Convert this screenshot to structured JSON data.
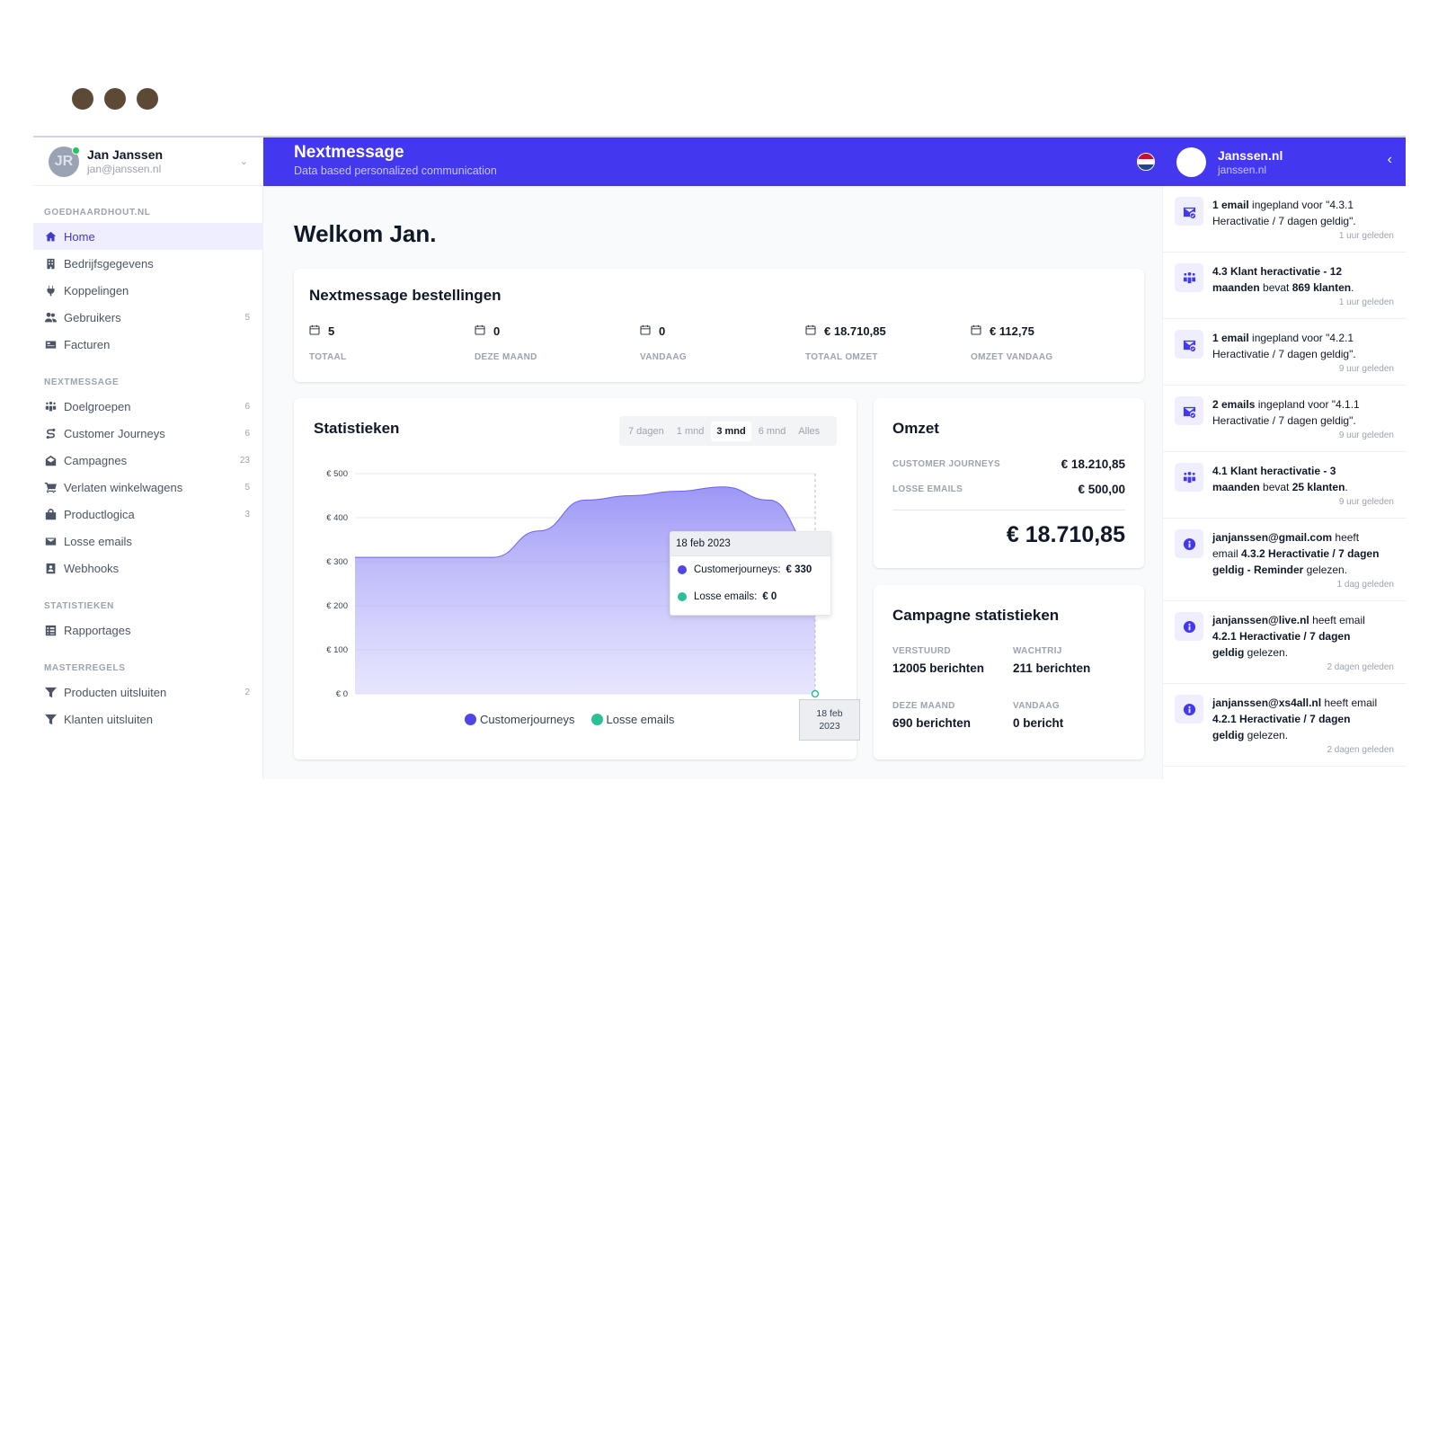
{
  "user": {
    "initials": "JR",
    "name": "Jan Janssen",
    "email": "jan@janssen.nl"
  },
  "nav": [
    {
      "section": "GOEDHAARDHOUT.NL",
      "items": [
        {
          "label": "Home",
          "icon": "home-icon",
          "count": "",
          "active": true
        },
        {
          "label": "Bedrijfsgegevens",
          "icon": "building-icon",
          "count": ""
        },
        {
          "label": "Koppelingen",
          "icon": "plug-icon",
          "count": ""
        },
        {
          "label": "Gebruikers",
          "icon": "users-icon",
          "count": "5"
        },
        {
          "label": "Facturen",
          "icon": "invoice-icon",
          "count": ""
        }
      ]
    },
    {
      "section": "NEXTMESSAGE",
      "items": [
        {
          "label": "Doelgroepen",
          "icon": "group-icon",
          "count": "6"
        },
        {
          "label": "Customer Journeys",
          "icon": "route-icon",
          "count": "6"
        },
        {
          "label": "Campagnes",
          "icon": "mail-open-icon",
          "count": "23"
        },
        {
          "label": "Verlaten winkelwagens",
          "icon": "cart-icon",
          "count": "5"
        },
        {
          "label": "Productlogica",
          "icon": "bag-icon",
          "count": "3"
        },
        {
          "label": "Losse emails",
          "icon": "mail-icon",
          "count": ""
        },
        {
          "label": "Webhooks",
          "icon": "webhook-icon",
          "count": ""
        }
      ]
    },
    {
      "section": "STATISTIEKEN",
      "items": [
        {
          "label": "Rapportages",
          "icon": "report-icon",
          "count": ""
        }
      ]
    },
    {
      "section": "MASTERREGELS",
      "items": [
        {
          "label": "Producten uitsluiten",
          "icon": "filter-icon",
          "count": "2"
        },
        {
          "label": "Klanten uitsluiten",
          "icon": "filter-icon",
          "count": ""
        }
      ]
    }
  ],
  "header": {
    "title": "Nextmessage",
    "subtitle": "Data based personalized communication",
    "account_name": "Janssen.nl",
    "account_domain": "janssen.nl"
  },
  "welcome": "Welkom Jan.",
  "orders": {
    "title": "Nextmessage bestellingen",
    "stats": [
      {
        "value": "5",
        "label": "TOTAAL"
      },
      {
        "value": "0",
        "label": "DEZE MAAND"
      },
      {
        "value": "0",
        "label": "VANDAAG"
      },
      {
        "value": "€ 18.710,85",
        "label": "TOTAAL OMZET"
      },
      {
        "value": "€ 112,75",
        "label": "OMZET VANDAAG"
      }
    ]
  },
  "statistics": {
    "title": "Statistieken",
    "ranges": [
      "7 dagen",
      "1 mnd",
      "3 mnd",
      "6 mnd",
      "Alles"
    ],
    "selected_range": "3 mnd",
    "tooltip": {
      "date": "18 feb 2023",
      "rows": [
        {
          "label": "Customerjourneys:",
          "value": "€ 330"
        },
        {
          "label": "Losse emails:",
          "value": "€ 0"
        }
      ]
    },
    "x_tooltip": [
      "18 feb",
      "2023"
    ]
  },
  "chart_data": {
    "type": "area",
    "ylim": [
      0,
      500
    ],
    "yticks": [
      "€ 0",
      "€ 100",
      "€ 200",
      "€ 300",
      "€ 400",
      "€ 500"
    ],
    "ytick_values": [
      0,
      100,
      200,
      300,
      400,
      500
    ],
    "x": [
      0,
      1,
      2,
      3,
      4,
      5,
      6,
      7,
      8,
      9,
      10
    ],
    "series": [
      {
        "name": "Customerjourneys",
        "color": "#4f46e5",
        "values": [
          310,
          310,
          310,
          310,
          370,
          440,
          450,
          460,
          470,
          440,
          330
        ]
      },
      {
        "name": "Losse emails",
        "color": "#2bbf95",
        "values": [
          0,
          0,
          0,
          0,
          0,
          0,
          0,
          0,
          0,
          0,
          0
        ]
      }
    ],
    "grid": true,
    "legend": "bottom"
  },
  "omzet": {
    "title": "Omzet",
    "rows": [
      {
        "label": "CUSTOMER JOURNEYS",
        "value": "€ 18.210,85"
      },
      {
        "label": "LOSSE EMAILS",
        "value": "€ 500,00"
      }
    ],
    "total": "€ 18.710,85"
  },
  "campagne": {
    "title": "Campagne statistieken",
    "items": [
      {
        "label": "VERSTUURD",
        "value": "12005 berichten"
      },
      {
        "label": "WACHTRIJ",
        "value": "211 berichten"
      },
      {
        "label": "DEZE MAAND",
        "value": "690 berichten"
      },
      {
        "label": "VANDAAG",
        "value": "0 bericht"
      }
    ]
  },
  "notifications": [
    {
      "icon": "mail-check-icon",
      "html": "<b>1 email</b> ingepland voor \"4.3.1 Heractivatie / 7 dagen geldig\".",
      "time": "1 uur geleden"
    },
    {
      "icon": "group-icon",
      "html": "<b>4.3 Klant heractivatie - 12 maanden</b> bevat <b>869 klanten</b>.",
      "time": "1 uur geleden"
    },
    {
      "icon": "mail-check-icon",
      "html": "<b>1 email</b> ingepland voor \"4.2.1 Heractivatie / 7 dagen geldig\".",
      "time": "9 uur geleden"
    },
    {
      "icon": "mail-check-icon",
      "html": "<b>2 emails</b> ingepland voor \"4.1.1 Heractivatie / 7 dagen geldig\".",
      "time": "9 uur geleden"
    },
    {
      "icon": "group-icon",
      "html": "<b>4.1 Klant heractivatie - 3 maanden</b> bevat <b>25 klanten</b>.",
      "time": "9 uur geleden"
    },
    {
      "icon": "info-icon",
      "html": "<b>janjanssen@gmail.com</b> heeft email <b>4.3.2 Heractivatie / 7 dagen geldig - Reminder</b> gelezen.",
      "time": "1 dag geleden"
    },
    {
      "icon": "info-icon",
      "html": "<b>janjanssen@live.nl</b> heeft email <b>4.2.1 Heractivatie / 7 dagen geldig</b> gelezen.",
      "time": "2 dagen geleden"
    },
    {
      "icon": "info-icon",
      "html": "<b>janjanssen@xs4all.nl</b> heeft email <b>4.2.1 Heractivatie / 7 dagen geldig</b> gelezen.",
      "time": "2 dagen geleden"
    }
  ],
  "colors": {
    "accent": "#4338f0",
    "green": "#2bbf95",
    "window_dots": "#5c4a37"
  }
}
